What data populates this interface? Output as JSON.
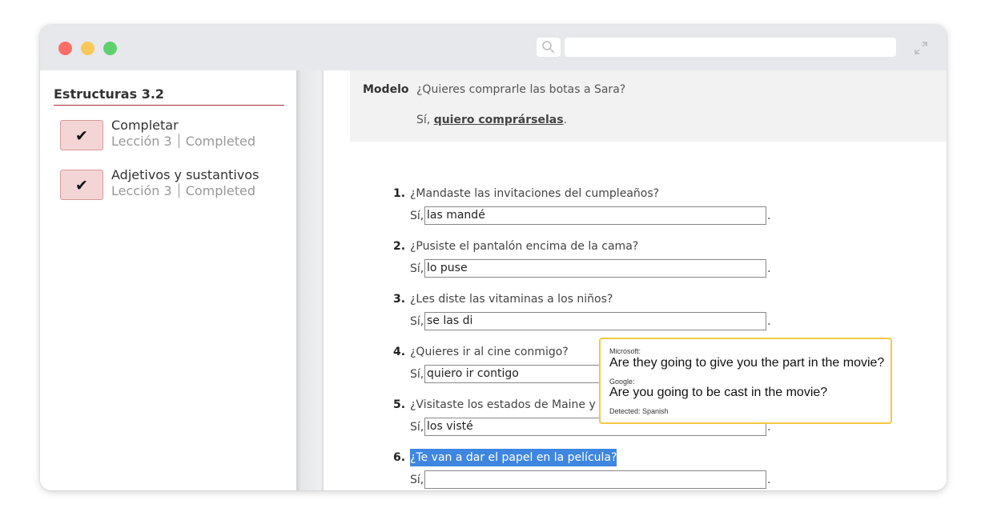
{
  "sidebar": {
    "title": "Estructuras 3.2",
    "items": [
      {
        "check": "✔",
        "name": "Completar",
        "lesson": "Lección 3",
        "status": "Completed"
      },
      {
        "check": "✔",
        "name": "Adjetivos y sustantivos",
        "lesson": "Lección 3",
        "status": "Completed"
      }
    ]
  },
  "model": {
    "label": "Modelo",
    "question": "¿Quieres comprarle las botas a Sara?",
    "answer_prefix": "Sí, ",
    "answer_bold": "quiero comprárselas",
    "answer_suffix": "."
  },
  "questions": [
    {
      "number": "1.",
      "question": "¿Mandaste las invitaciones del cumpleaños?",
      "si": "Sí,",
      "answer": "las mandé",
      "end": "."
    },
    {
      "number": "2.",
      "question": "¿Pusiste el pantalón encima de la cama?",
      "si": "Sí,",
      "answer": "lo puse",
      "end": "."
    },
    {
      "number": "3.",
      "question": "¿Les diste las vitaminas a los niños?",
      "si": "Sí,",
      "answer": "se las di",
      "end": "."
    },
    {
      "number": "4.",
      "question": "¿Quieres ir al cine conmigo?",
      "si": "Sí,",
      "answer": "quiero ir contigo",
      "end": "."
    },
    {
      "number": "5.",
      "question": "¿Visitaste los estados de Maine y Ma",
      "si": "Sí,",
      "answer": "los visté",
      "end": "."
    },
    {
      "number": "6.",
      "question": "¿Te van a dar el papel en la película?",
      "si": "Sí,",
      "answer": "",
      "end": "."
    }
  ],
  "translation_tooltip": {
    "source1": "Microsoft:",
    "text1": "Are they going to give you the part in the movie?",
    "source2": "Google:",
    "text2": "Are you going to be cast in the movie?",
    "detected": "Detected: Spanish",
    "border_color": "#f5c842"
  },
  "colors": {
    "highlight": "#3f86e0",
    "accent_rule": "#a83236",
    "check_bg": "#f4d5d6"
  }
}
